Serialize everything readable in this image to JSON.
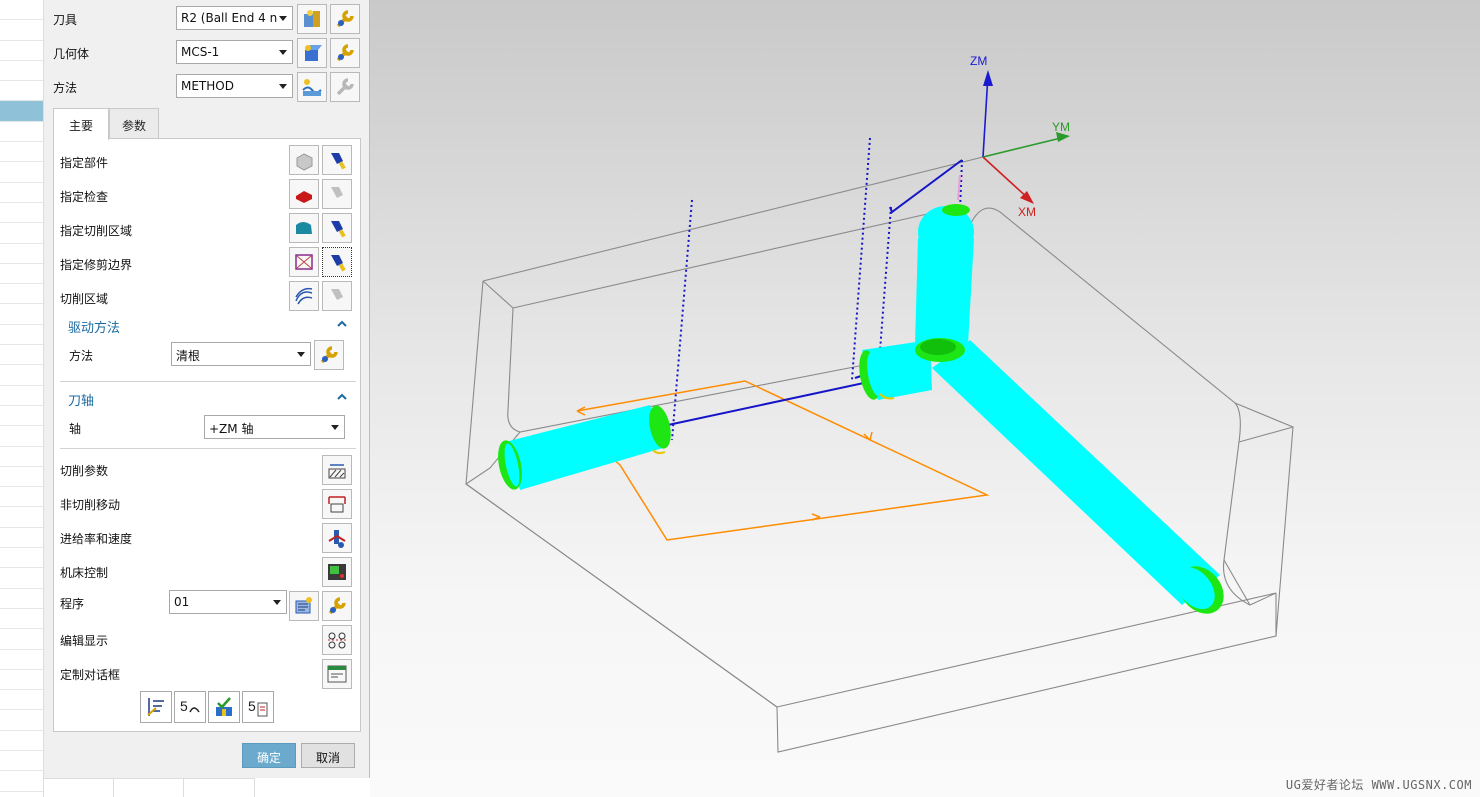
{
  "dialog": {
    "tool": {
      "label": "刀具",
      "value": "R2 (Ball End 4 n"
    },
    "geometry": {
      "label": "几何体",
      "value": "MCS-1"
    },
    "method": {
      "label": "方法",
      "value": "METHOD"
    },
    "tabs": [
      {
        "label": "主要"
      },
      {
        "label": "参数"
      }
    ],
    "rows": [
      {
        "label": "指定部件"
      },
      {
        "label": "指定检查"
      },
      {
        "label": "指定切削区域"
      },
      {
        "label": "指定修剪边界"
      },
      {
        "label": "切削区域"
      }
    ],
    "drive_section": {
      "title": "驱动方法",
      "method_label": "方法",
      "method_value": "清根"
    },
    "axis_section": {
      "title": "刀轴",
      "axis_label": "轴",
      "axis_value": "+ZM 轴"
    },
    "settings": [
      {
        "label": "切削参数"
      },
      {
        "label": "非切削移动"
      },
      {
        "label": "进给率和速度"
      },
      {
        "label": "机床控制"
      }
    ],
    "program": {
      "label": "程序",
      "value": "01"
    },
    "edit_display": {
      "label": "编辑显示"
    },
    "custom_dialog": {
      "label": "定制对话框"
    },
    "ok_label": "确定",
    "cancel_label": "取消"
  },
  "viewport": {
    "axes": {
      "z": "ZM",
      "y": "YM",
      "x": "XM"
    },
    "watermark": "UG爱好者论坛 WWW.UGSNX.COM"
  },
  "colors": {
    "accent": "#1b6aa0",
    "tool_body": "#00ffff",
    "tool_cap": "#1ee614",
    "path_blue": "#1515c8",
    "path_orange": "#ff8c00",
    "ok_button": "#6ba9cd"
  },
  "icons": [
    "tool-new-icon",
    "wrench-icon",
    "geometry-icon",
    "method-icon",
    "part-cube-icon",
    "flashlight-icon",
    "check-icon",
    "cut-area-icon",
    "trim-boundary-icon",
    "cut-region-icon",
    "cut-params-icon",
    "non-cut-moves-icon",
    "feeds-speeds-icon",
    "machine-control-icon",
    "program-icon",
    "edit-display-icon",
    "custom-dialog-icon",
    "generate-icon",
    "replay-icon",
    "verify-icon",
    "list-icon"
  ]
}
